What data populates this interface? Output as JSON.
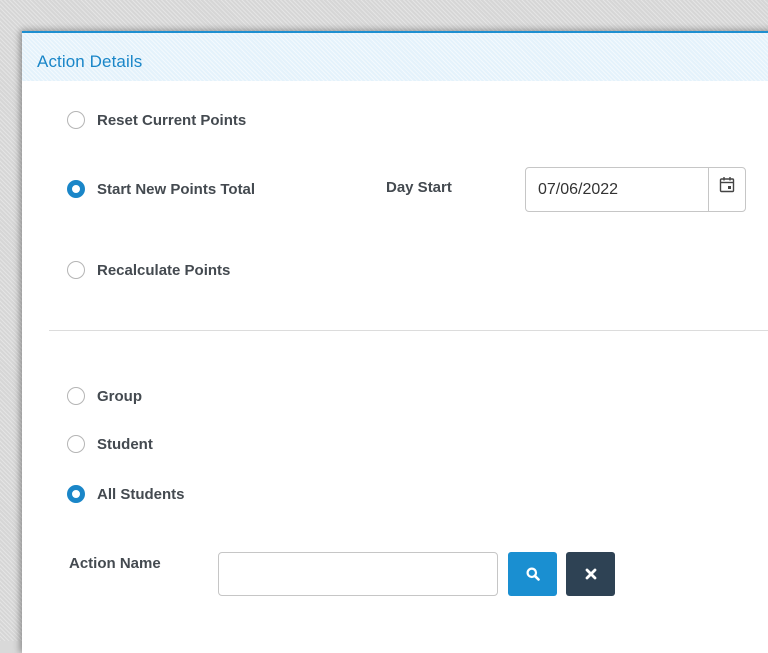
{
  "panel": {
    "title": "Action Details"
  },
  "points_options": [
    {
      "label": "Reset Current Points",
      "checked": false
    },
    {
      "label": "Start New Points Total",
      "checked": true
    },
    {
      "label": "Recalculate Points",
      "checked": false
    }
  ],
  "day_start": {
    "label": "Day Start",
    "value": "07/06/2022",
    "icon": "calendar-icon"
  },
  "scope_options": [
    {
      "label": "Group",
      "checked": false
    },
    {
      "label": "Student",
      "checked": false
    },
    {
      "label": "All Students",
      "checked": true
    }
  ],
  "action_name": {
    "label": "Action Name",
    "value": "",
    "placeholder": ""
  },
  "buttons": {
    "search_icon": "search-icon",
    "clear_icon": "close-icon"
  },
  "colors": {
    "accent": "#1a86c8",
    "dark_button": "#2e4254",
    "header_bg": "#e4f2fb"
  }
}
